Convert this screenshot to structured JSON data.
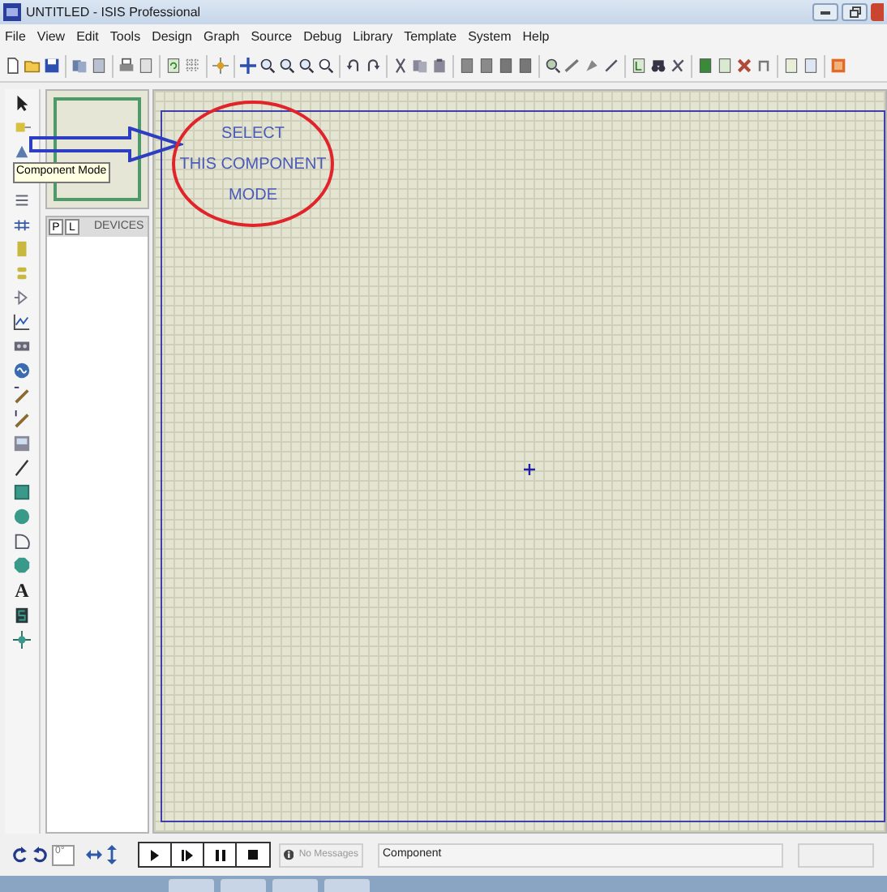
{
  "window": {
    "title": "UNTITLED - ISIS Professional"
  },
  "menu": [
    "File",
    "View",
    "Edit",
    "Tools",
    "Design",
    "Graph",
    "Source",
    "Debug",
    "Library",
    "Template",
    "System",
    "Help"
  ],
  "mode_toolbar": {
    "text_glyph": "A"
  },
  "side_panel": {
    "tabs": [
      "P",
      "L"
    ],
    "heading": "DEVICES"
  },
  "tooltip": "Component Mode",
  "annotation": {
    "lines": [
      "SELECT",
      "THIS COMPONENT",
      "MODE"
    ]
  },
  "status_bar": {
    "rotation": "0°",
    "messages": "No Messages",
    "status": "Component"
  }
}
